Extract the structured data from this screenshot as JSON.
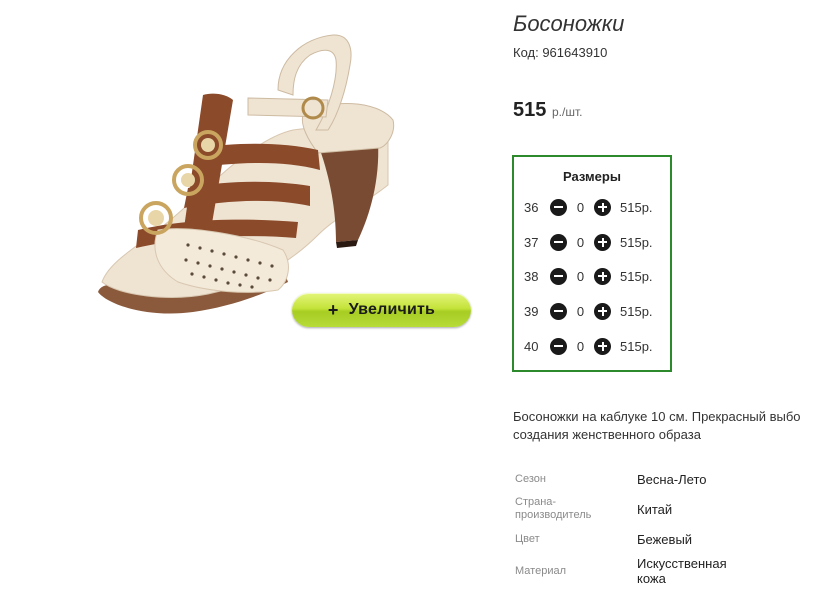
{
  "product": {
    "title": "Босоножки",
    "code": "Код: 961643910",
    "price_amount": "515",
    "price_unit": "р./шт.",
    "zoom_label": "Увеличить"
  },
  "sizes": {
    "title": "Размеры",
    "rows": [
      {
        "size": "36",
        "qty": "0",
        "price": "515р."
      },
      {
        "size": "37",
        "qty": "0",
        "price": "515р."
      },
      {
        "size": "38",
        "qty": "0",
        "price": "515р."
      },
      {
        "size": "39",
        "qty": "0",
        "price": "515р."
      },
      {
        "size": "40",
        "qty": "0",
        "price": "515р."
      }
    ]
  },
  "description": {
    "line1": "Босоножки на каблуке 10 см. Прекрасный выбо",
    "line2": "создания женственного образа"
  },
  "properties": [
    {
      "label": "Сезон",
      "value": "Весна-Лето"
    },
    {
      "label": "Страна-\nпроизводитель",
      "value": "Китай"
    },
    {
      "label": "Цвет",
      "value": "Бежевый"
    },
    {
      "label": "Материал",
      "value": "Искусственная\nкожа"
    }
  ],
  "colors": {
    "sizes_border": "#2c8a2c",
    "zoom_button": "#b7dc39",
    "strap_brown": "#8b4a2a",
    "sandal_beige": "#ede0cf"
  }
}
